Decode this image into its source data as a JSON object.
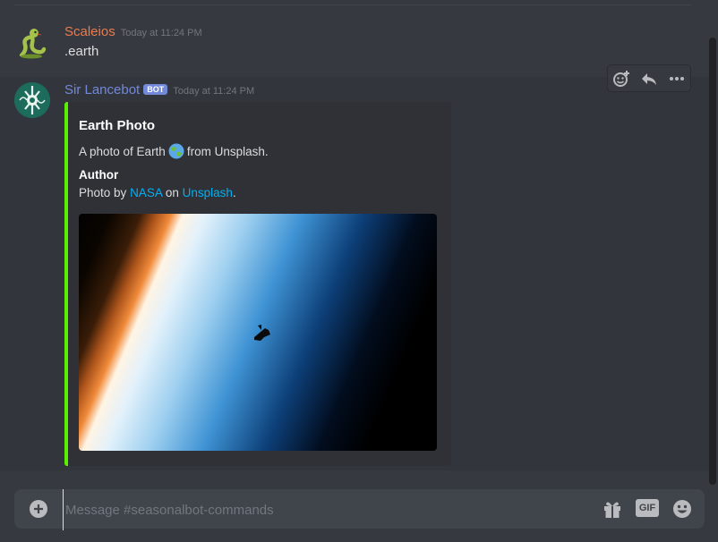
{
  "messages": [
    {
      "username": "Scaleios",
      "timestamp": "Today at 11:24 PM",
      "content": ".earth",
      "avatar_icon": "snake-avatar-icon"
    },
    {
      "username": "Sir Lancebot",
      "bot_tag": "BOT",
      "timestamp": "Today at 11:24 PM",
      "avatar_icon": "bot-avatar-icon",
      "embed": {
        "accent_color": "#59f000",
        "title": "Earth Photo",
        "description_before": "A photo of Earth",
        "description_emoji": "earth-globe-icon",
        "description_after": "from Unsplash.",
        "field_name": "Author",
        "field_value_prefix": "Photo by",
        "field_link1": "NASA",
        "field_value_mid": "on",
        "field_link2": "Unsplash",
        "field_value_suffix": ".",
        "image": "earth-horizon-shuttle-image"
      }
    }
  ],
  "toolbar": {
    "icons": [
      "add-reaction-icon",
      "reply-icon",
      "more-icon"
    ]
  },
  "chatbar": {
    "placeholder": "Message #seasonalbot-commands",
    "value": "",
    "icons": [
      "attach-plus-icon",
      "gift-icon",
      "gif-icon",
      "emoji-icon"
    ],
    "gif_label": "GIF"
  },
  "colors": {
    "background": "#36393f",
    "hover_background": "#32353b",
    "embed_background": "#2f3136",
    "link": "#00b0f4",
    "bot_name": "#7289da",
    "user_name": "#ed7b4c"
  }
}
